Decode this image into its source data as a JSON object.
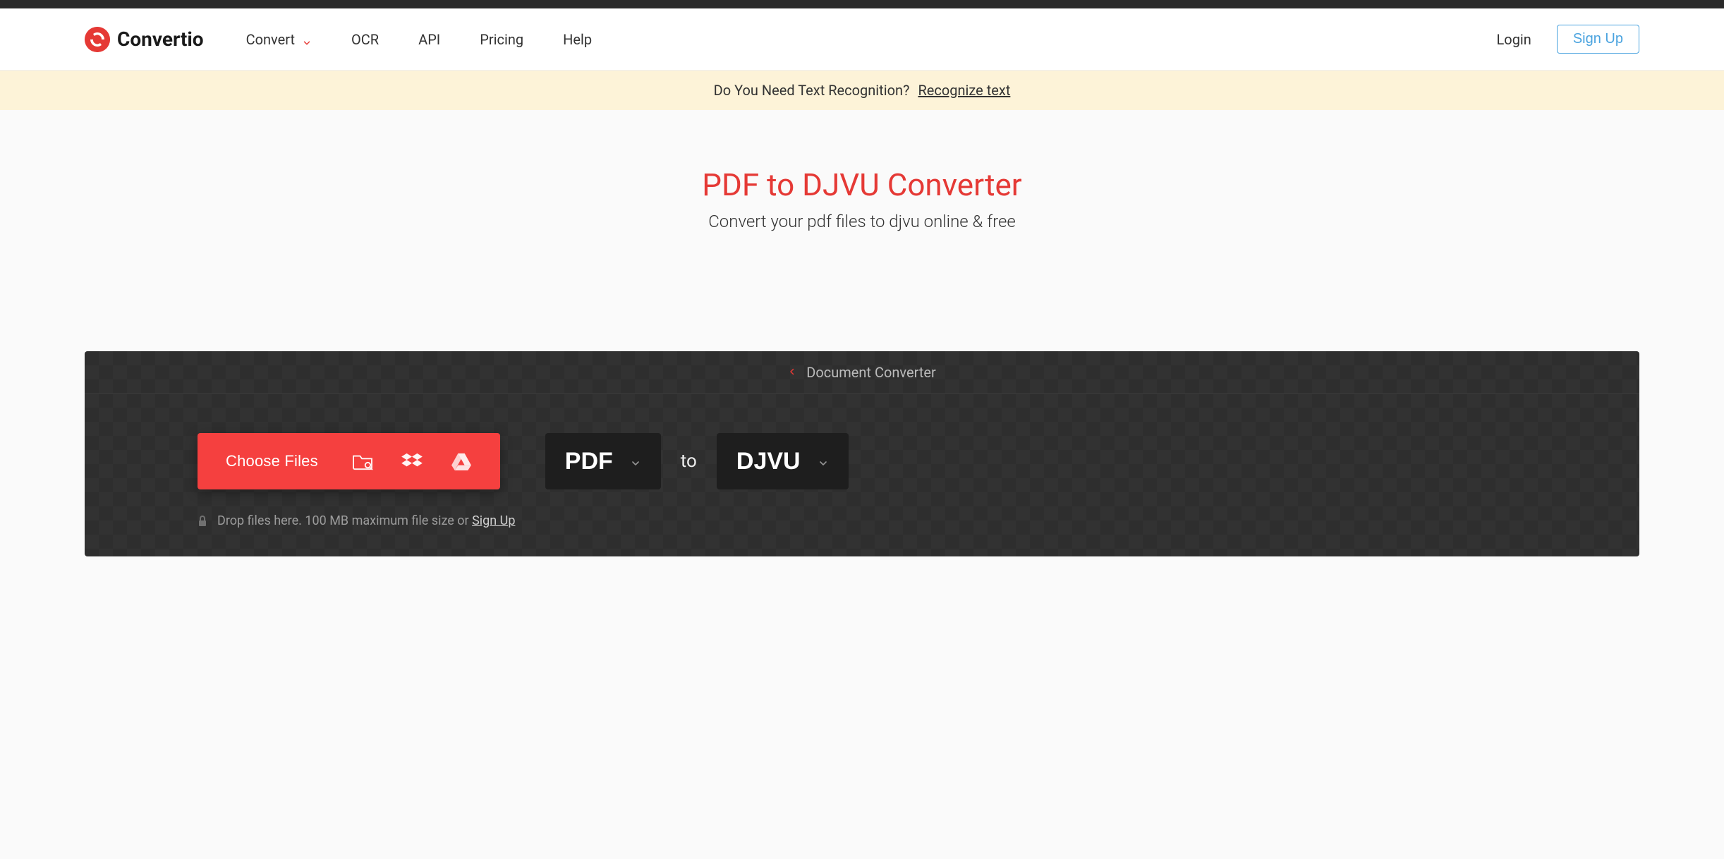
{
  "brand": {
    "name": "Convertio"
  },
  "nav": {
    "convert": "Convert",
    "ocr": "OCR",
    "api": "API",
    "pricing": "Pricing",
    "help": "Help"
  },
  "auth": {
    "login": "Login",
    "signup": "Sign Up"
  },
  "banner": {
    "question": "Do You Need Text Recognition?",
    "link": "Recognize text"
  },
  "hero": {
    "title": "PDF to DJVU Converter",
    "subtitle": "Convert your pdf files to djvu online & free"
  },
  "converter": {
    "breadcrumb": "Document Converter",
    "choose_label": "Choose Files",
    "from": "PDF",
    "to_label": "to",
    "to": "DJVU",
    "drop_prefix": "Drop files here. 100 MB maximum file size or ",
    "signup": "Sign Up"
  }
}
